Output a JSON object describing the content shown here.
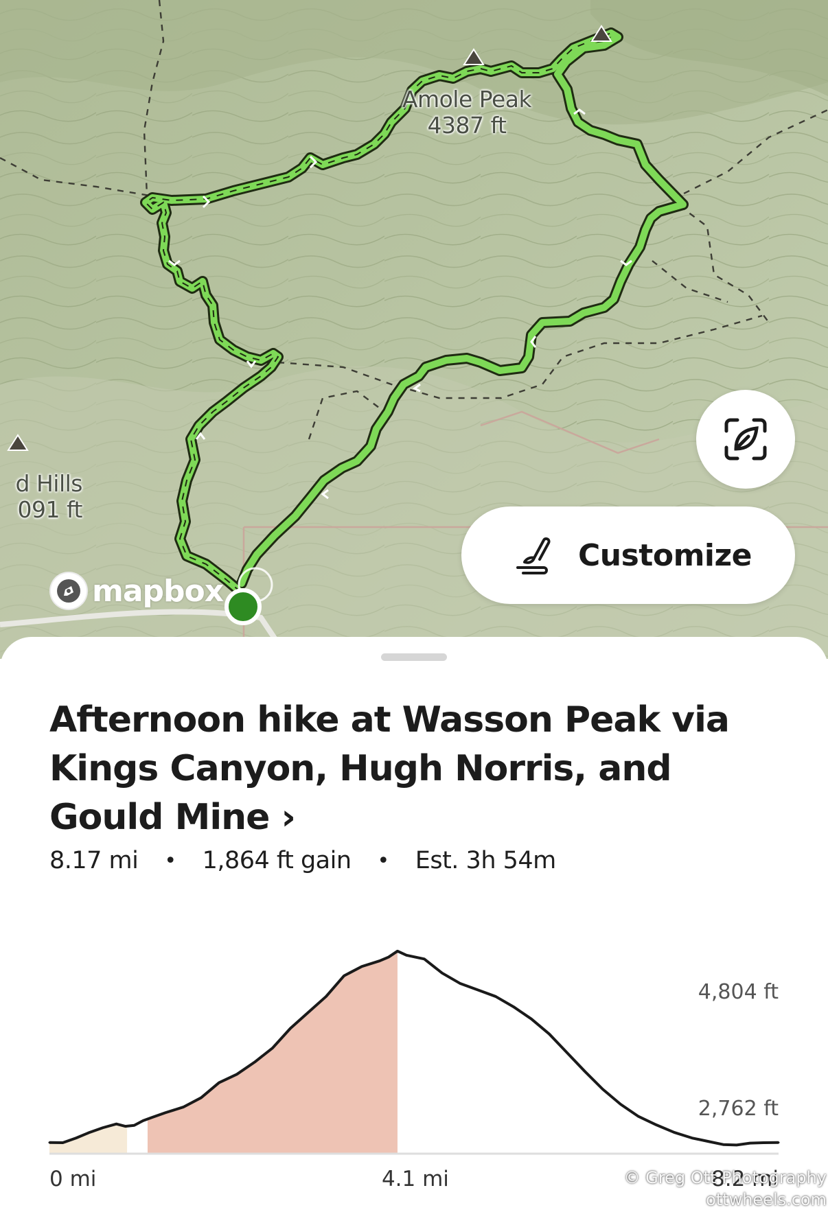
{
  "map": {
    "peaks": [
      {
        "name": "Amole Peak",
        "elevation": "4387 ft"
      },
      {
        "name": "d Hills",
        "elevation": "091 ft"
      }
    ],
    "attribution": "mapbox",
    "customize_label": "Customize",
    "icons": {
      "recenter": "recenter-icon",
      "customize": "brush-icon",
      "attribution": "mapbox-logo-icon",
      "start": "start-marker-icon",
      "peak": "peak-triangle-icon"
    },
    "colors": {
      "terrain": "#b8c4a2",
      "route": "#7ed957",
      "route_outline": "#1e2a12",
      "start_marker": "#2e8b22"
    }
  },
  "activity": {
    "title": "Afternoon hike at Wasson Peak via Kings Canyon, Hugh Norris, and Gould Mine ›",
    "distance": "8.17 mi",
    "gain": "1,864 ft gain",
    "estimate": "Est. 3h 54m",
    "separator": "•"
  },
  "watermark": {
    "line1": "© Greg Ott Photography",
    "line2": "ottwheels.com"
  },
  "chart_data": {
    "type": "area",
    "title": "",
    "xlabel": "",
    "ylabel": "",
    "x_unit": "mi",
    "y_unit": "ft",
    "xlim": [
      0,
      8.17
    ],
    "ylim": [
      2650,
      4920
    ],
    "y_ticks": [
      "4,804 ft",
      "2,762 ft"
    ],
    "x_ticks": [
      "0 mi",
      "4.1 mi",
      "8.2 mi"
    ],
    "grid": false,
    "legend": "none",
    "series": [
      {
        "x": [
          0,
          0.15,
          0.3,
          0.45,
          0.6,
          0.75,
          0.85,
          0.95,
          1.05,
          1.15,
          1.3,
          1.5,
          1.7,
          1.9,
          2.1,
          2.3,
          2.5,
          2.7,
          2.9,
          3.1,
          3.3,
          3.5,
          3.7,
          3.8,
          3.9,
          4.0,
          4.2,
          4.4,
          4.6,
          4.8,
          5.0,
          5.2,
          5.4,
          5.6,
          5.8,
          6.0,
          6.2,
          6.4,
          6.6,
          6.8,
          7.0,
          7.2,
          7.4,
          7.55,
          7.7,
          7.85,
          8.0,
          8.17
        ],
        "y": [
          2762,
          2760,
          2810,
          2870,
          2920,
          2960,
          2935,
          2945,
          2995,
          3030,
          3080,
          3140,
          3240,
          3400,
          3490,
          3620,
          3770,
          3980,
          4150,
          4320,
          4540,
          4640,
          4700,
          4740,
          4804,
          4760,
          4720,
          4570,
          4460,
          4390,
          4320,
          4210,
          4080,
          3920,
          3720,
          3520,
          3330,
          3170,
          3040,
          2950,
          2870,
          2810,
          2770,
          2740,
          2735,
          2755,
          2760,
          2762
        ]
      }
    ],
    "highlighted_ranges": [
      {
        "from": 0,
        "to": 0.87,
        "color": "#f6ead7"
      },
      {
        "from": 1.1,
        "to": 3.9,
        "color": "#eec3b4"
      }
    ]
  }
}
